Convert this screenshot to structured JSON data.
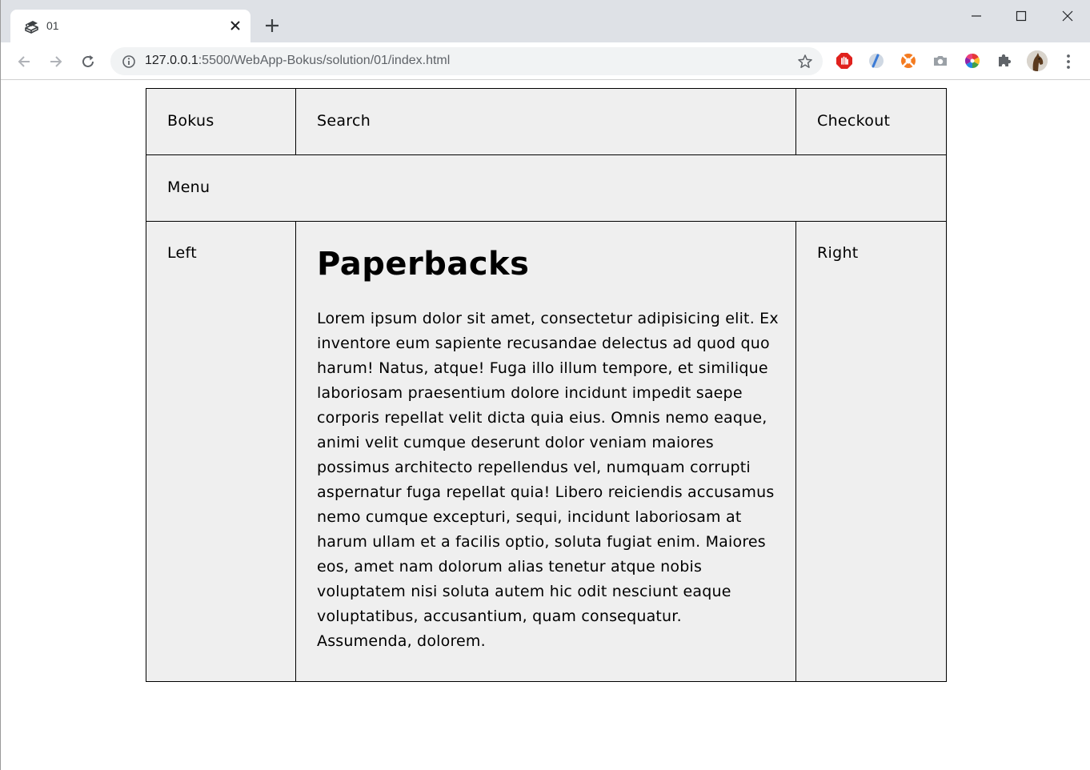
{
  "browser": {
    "tab": {
      "title": "01"
    },
    "address": {
      "host": "127.0.0.1",
      "path": ":5500/WebApp-Bokus/solution/01/index.html"
    },
    "colors": {
      "tabstrip": "#dee1e6",
      "omnibox": "#f1f3f4"
    }
  },
  "page": {
    "header": {
      "logo": "Bokus",
      "search": "Search",
      "checkout": "Checkout"
    },
    "menu": "Menu",
    "left": "Left",
    "right": "Right",
    "main": {
      "title": "Paperbacks",
      "text": "Lorem ipsum dolor sit amet, consectetur adipisicing elit. Ex inventore eum sapiente recusandae delectus ad quod quo harum! Natus, atque! Fuga illo illum tempore, et similique laboriosam praesentium dolore incidunt impedit saepe corporis repellat velit dicta quia eius. Omnis nemo eaque, animi velit cumque deserunt dolor veniam maiores possimus architecto repellendus vel, numquam corrupti aspernatur fuga repellat quia! Libero reiciendis accusamus nemo cumque excepturi, sequi, incidunt laboriosam at harum ullam et a facilis optio, soluta fugiat enim. Maiores eos, amet nam dolorum alias tenetur atque nobis voluptatem nisi soluta autem hic odit nesciunt eaque voluptatibus, accusantium, quam consequatur. Assumenda, dolorem."
    },
    "colors": {
      "cell_background": "#efefef",
      "border": "#000000"
    }
  }
}
